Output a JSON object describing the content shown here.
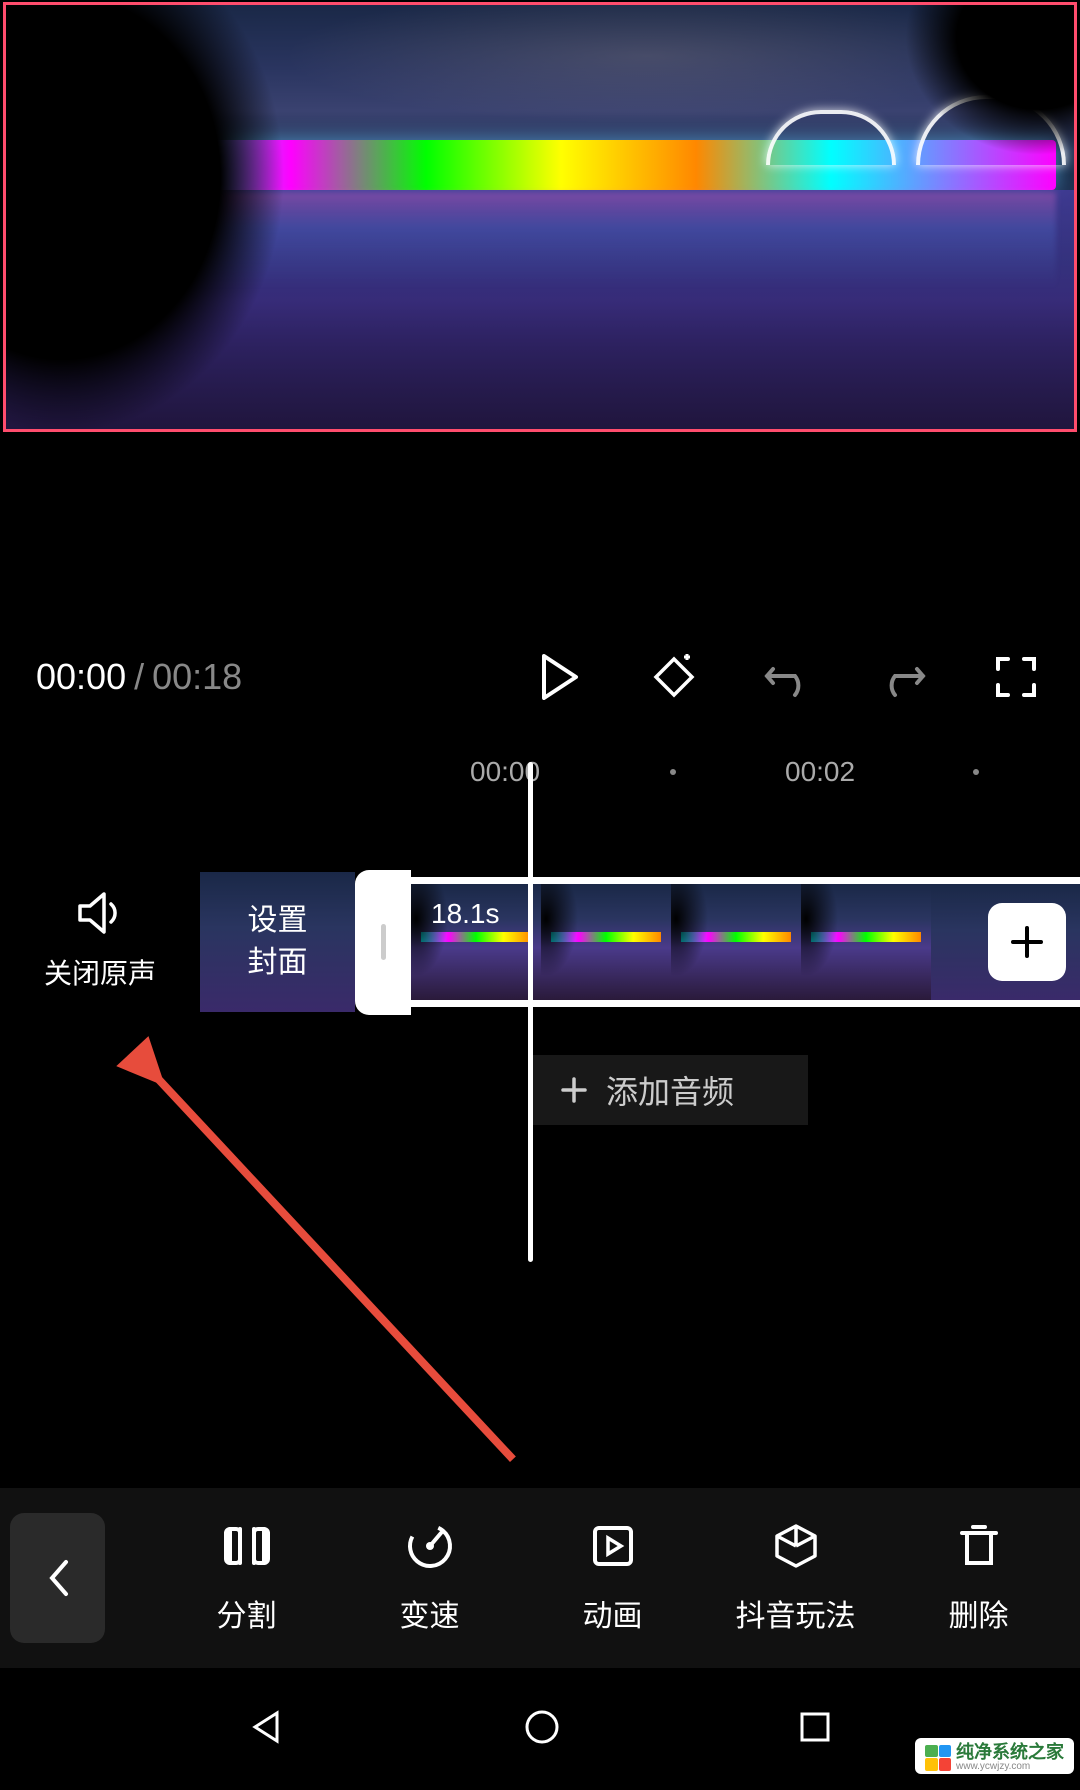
{
  "preview": {
    "selected": true
  },
  "playback": {
    "current": "00:00",
    "separator": "/",
    "total": "00:18"
  },
  "ruler": {
    "t0": "00:00",
    "t1": "00:02"
  },
  "audio_toggle": {
    "label": "关闭原声"
  },
  "cover": {
    "line1": "设置",
    "line2": "封面"
  },
  "clip": {
    "duration": "18.1s"
  },
  "add_audio": {
    "label": "添加音频"
  },
  "toolbar": {
    "items": [
      {
        "label": "分割"
      },
      {
        "label": "变速"
      },
      {
        "label": "动画"
      },
      {
        "label": "抖音玩法"
      },
      {
        "label": "删除"
      }
    ]
  },
  "watermark": {
    "title": "纯净系统之家",
    "sub": "www.ycwjzy.com"
  }
}
